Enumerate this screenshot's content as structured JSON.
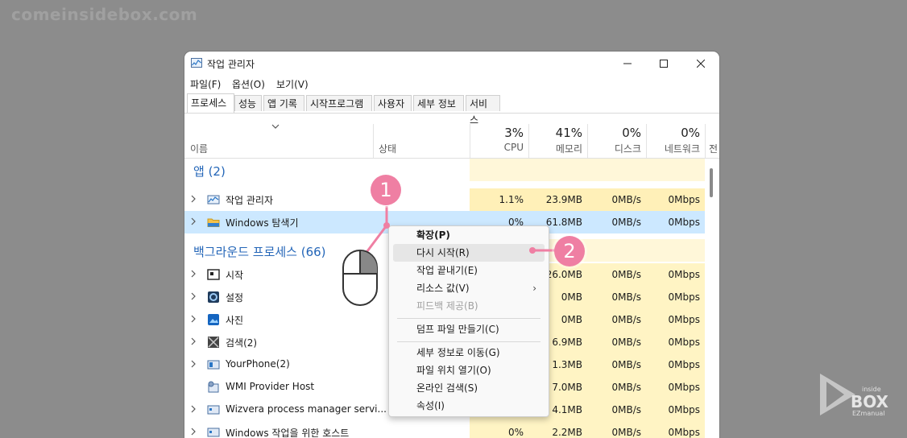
{
  "watermark": "comeinsidebox.com",
  "window": {
    "title": "작업 관리자",
    "controls": {
      "minimize": "—",
      "maximize": "☐",
      "close": "✕"
    }
  },
  "menu": [
    "파일(F)",
    "옵션(O)",
    "보기(V)"
  ],
  "tabs": [
    {
      "label": "프로세스",
      "active": true
    },
    {
      "label": "성능"
    },
    {
      "label": "앱 기록"
    },
    {
      "label": "시작프로그램"
    },
    {
      "label": "사용자"
    },
    {
      "label": "세부 정보"
    },
    {
      "label": "서비스"
    }
  ],
  "columns": {
    "name": "이름",
    "status": "상태",
    "cpu": {
      "pct": "3%",
      "label": "CPU"
    },
    "memory": {
      "pct": "41%",
      "label": "메모리"
    },
    "disk": {
      "pct": "0%",
      "label": "디스크"
    },
    "network": {
      "pct": "0%",
      "label": "네트워크"
    },
    "power": "전"
  },
  "groups": {
    "apps": "앱 (2)",
    "background": "백그라운드 프로세스 (66)"
  },
  "rows": {
    "task_manager": {
      "name": "작업 관리자",
      "cpu": "1.1%",
      "mem": "23.9MB",
      "disk": "0MB/s",
      "net": "0Mbps"
    },
    "explorer": {
      "name": "Windows 탐색기",
      "cpu": "0%",
      "mem": "61.8MB",
      "disk": "0MB/s",
      "net": "0Mbps"
    },
    "start": {
      "name": "시작",
      "mem": "26.0MB",
      "disk": "0MB/s",
      "net": "0Mbps"
    },
    "settings": {
      "name": "설정",
      "mem": "0MB",
      "disk": "0MB/s",
      "net": "0Mbps"
    },
    "photos": {
      "name": "사진",
      "mem": "0MB",
      "disk": "0MB/s",
      "net": "0Mbps"
    },
    "search": {
      "name": "검색(2)",
      "mem": "6.9MB",
      "disk": "0MB/s",
      "net": "0Mbps"
    },
    "yourphone": {
      "name": "YourPhone(2)",
      "mem": "1.3MB",
      "disk": "0MB/s",
      "net": "0Mbps"
    },
    "wmi": {
      "name": "WMI Provider Host",
      "mem": "7.0MB",
      "disk": "0MB/s",
      "net": "0Mbps"
    },
    "wizvera": {
      "name": "Wizvera process manager servi...",
      "mem": "4.1MB",
      "disk": "0MB/s",
      "net": "0Mbps"
    },
    "host": {
      "name": "Windows 작업을 위한 호스트",
      "cpu": "0%",
      "mem": "2.2MB",
      "disk": "0MB/s",
      "net": "0Mbps"
    }
  },
  "context_menu": {
    "expand": "확장(P)",
    "restart": "다시 시작(R)",
    "end_task": "작업 끝내기(E)",
    "resource_values": "리소스 값(V)",
    "feedback": "피드백 제공(B)",
    "dump": "덤프 파일 만들기(C)",
    "details": "세부 정보로 이동(G)",
    "open_location": "파일 위치 열기(O)",
    "search_online": "온라인 검색(S)",
    "properties": "속성(I)"
  },
  "annotations": {
    "step1": "1",
    "step2": "2"
  },
  "colors": {
    "accent": "#ef7fa3",
    "selected_row": "#cce8ff",
    "metric_bg": "#fff4c4",
    "group_text": "#2466b8"
  }
}
